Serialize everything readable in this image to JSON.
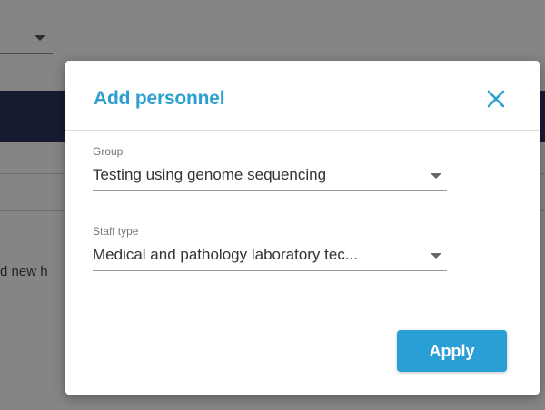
{
  "background": {
    "partial_text": "d new h",
    "colors": {
      "header_bar": "#2c3560"
    }
  },
  "modal": {
    "title": "Add personnel",
    "close_icon": "close-icon",
    "fields": [
      {
        "label": "Group",
        "value": "Testing using genome sequencing"
      },
      {
        "label": "Staff type",
        "value": "Medical and pathology laboratory tec..."
      }
    ],
    "apply_label": "Apply",
    "colors": {
      "accent": "#2a9fd6",
      "title": "#2a9fd0"
    }
  }
}
